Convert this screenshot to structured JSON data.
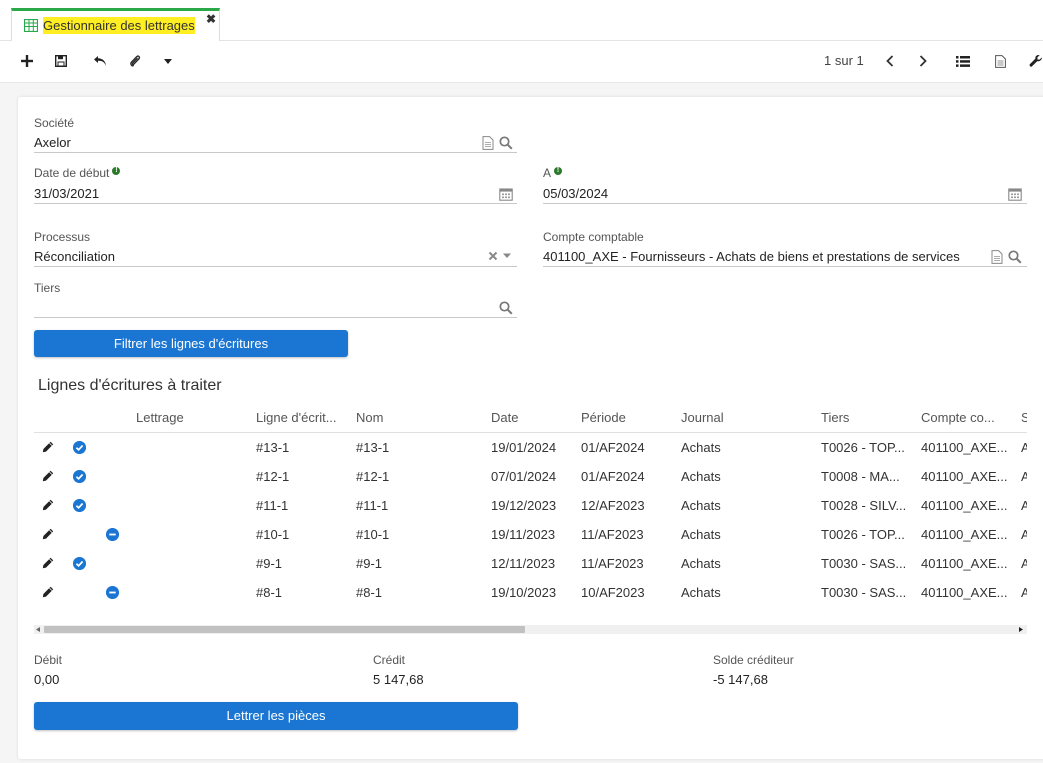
{
  "tab": {
    "title": "Gestionnaire des lettrages",
    "icon": "grid-table-icon"
  },
  "toolbar": {
    "buttons": [
      "plus-icon",
      "save-icon",
      "undo-icon",
      "paperclip-icon",
      "caret-down-icon"
    ],
    "pager_text": "1 sur 1",
    "right_icons": [
      "chevron-left-icon",
      "chevron-right-icon",
      "list-view-icon",
      "document-icon",
      "wrench-icon"
    ]
  },
  "form": {
    "societe_label": "Société",
    "societe_value": "Axelor",
    "date_debut_label": "Date de début",
    "date_debut_value": "31/03/2021",
    "a_label": "A",
    "a_value": "05/03/2024",
    "processus_label": "Processus",
    "processus_value": "Réconciliation",
    "compte_label": "Compte comptable",
    "compte_value": "401100_AXE - Fournisseurs - Achats de biens et prestations de services",
    "tiers_label": "Tiers",
    "tiers_value": ""
  },
  "filter_button": "Filtrer les lignes d'écritures",
  "lines_title": "Lignes d'écritures à traiter",
  "grid": {
    "headers": [
      "Lettrage",
      "Ligne d'écrit...",
      "Nom",
      "Date",
      "Période",
      "Journal",
      "Tiers",
      "Compte co...",
      "S"
    ],
    "rows": [
      {
        "status": "check",
        "ligne": "#13-1",
        "nom": "#13-1",
        "date": "19/01/2024",
        "periode": "01/AF2024",
        "journal": "Achats",
        "tiers": "T0026 - TOP...",
        "compte": "401100_AXE...",
        "s": "A"
      },
      {
        "status": "check",
        "ligne": "#12-1",
        "nom": "#12-1",
        "date": "07/01/2024",
        "periode": "01/AF2024",
        "journal": "Achats",
        "tiers": "T0008 - MA...",
        "compte": "401100_AXE...",
        "s": "A"
      },
      {
        "status": "check",
        "ligne": "#11-1",
        "nom": "#11-1",
        "date": "19/12/2023",
        "periode": "12/AF2023",
        "journal": "Achats",
        "tiers": "T0028 - SILV...",
        "compte": "401100_AXE...",
        "s": "A"
      },
      {
        "status": "minus",
        "ligne": "#10-1",
        "nom": "#10-1",
        "date": "19/11/2023",
        "periode": "11/AF2023",
        "journal": "Achats",
        "tiers": "T0026 - TOP...",
        "compte": "401100_AXE...",
        "s": "A"
      },
      {
        "status": "check",
        "ligne": "#9-1",
        "nom": "#9-1",
        "date": "12/11/2023",
        "periode": "11/AF2023",
        "journal": "Achats",
        "tiers": "T0030 - SAS...",
        "compte": "401100_AXE...",
        "s": "A"
      },
      {
        "status": "minus",
        "ligne": "#8-1",
        "nom": "#8-1",
        "date": "19/10/2023",
        "periode": "10/AF2023",
        "journal": "Achats",
        "tiers": "T0030 - SAS...",
        "compte": "401100_AXE...",
        "s": "A"
      }
    ]
  },
  "totals": {
    "debit_label": "Débit",
    "debit_value": "0,00",
    "credit_label": "Crédit",
    "credit_value": "5 147,68",
    "solde_label": "Solde créditeur",
    "solde_value": "-5 147,68"
  },
  "letter_button": "Lettrer les pièces",
  "colors": {
    "accent": "#1a76d2",
    "tab_highlight": "#ffee22",
    "tab_border": "#2aa84a",
    "info": "#2b7a2b"
  }
}
